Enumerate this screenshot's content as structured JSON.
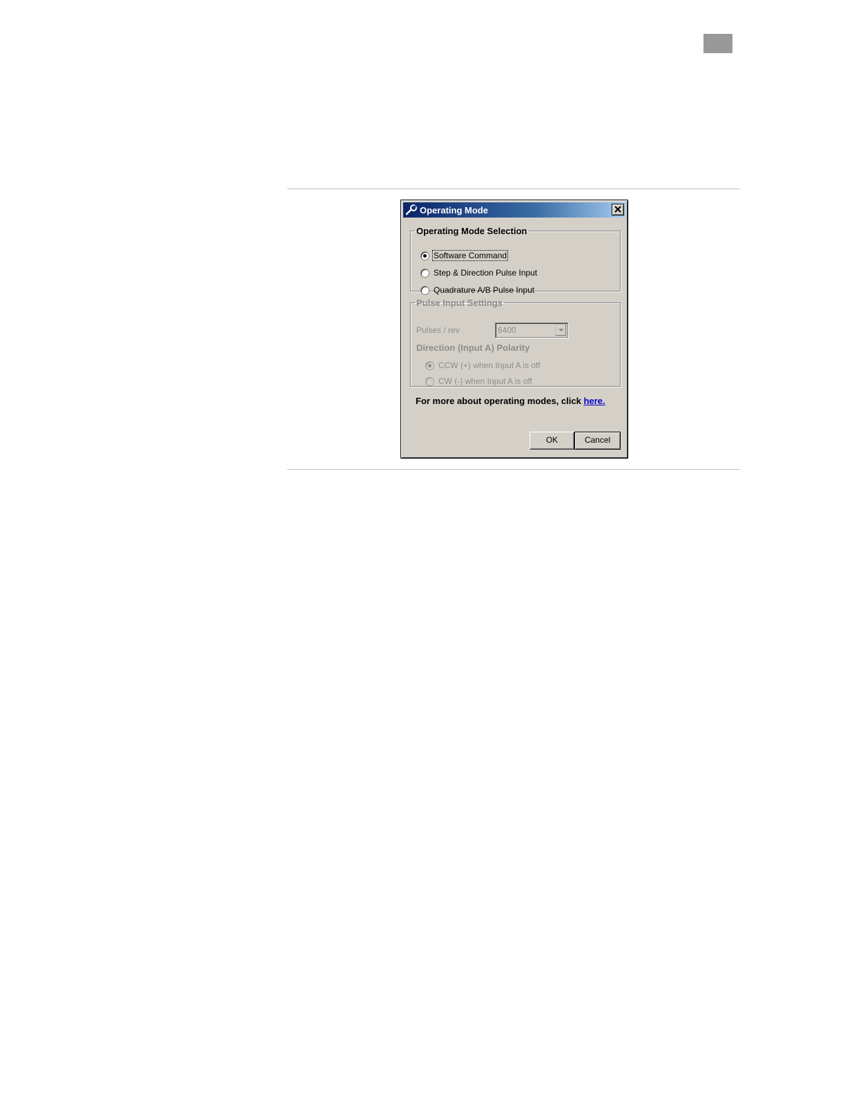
{
  "dialog": {
    "title": "Operating Mode",
    "mode_group": {
      "legend": "Operating Mode Selection",
      "options": [
        {
          "label": "Software Command",
          "selected": true
        },
        {
          "label": "Step & Direction Pulse Input",
          "selected": false
        },
        {
          "label": "Quadrature A/B Pulse Input",
          "selected": false
        }
      ]
    },
    "pulse_group": {
      "legend": "Pulse Input Settings",
      "pulses_label": "Pulses / rev",
      "pulses_value": "6400",
      "polarity_heading": "Direction (Input A) Polarity",
      "polarity_options": [
        {
          "label": "CCW (+) when Input A is off",
          "selected": true
        },
        {
          "label": "CW (-) when Input A is off",
          "selected": false
        }
      ]
    },
    "info_text": "For more about operating modes, click",
    "info_link": "here.",
    "ok_label": "OK",
    "cancel_label": "Cancel"
  }
}
